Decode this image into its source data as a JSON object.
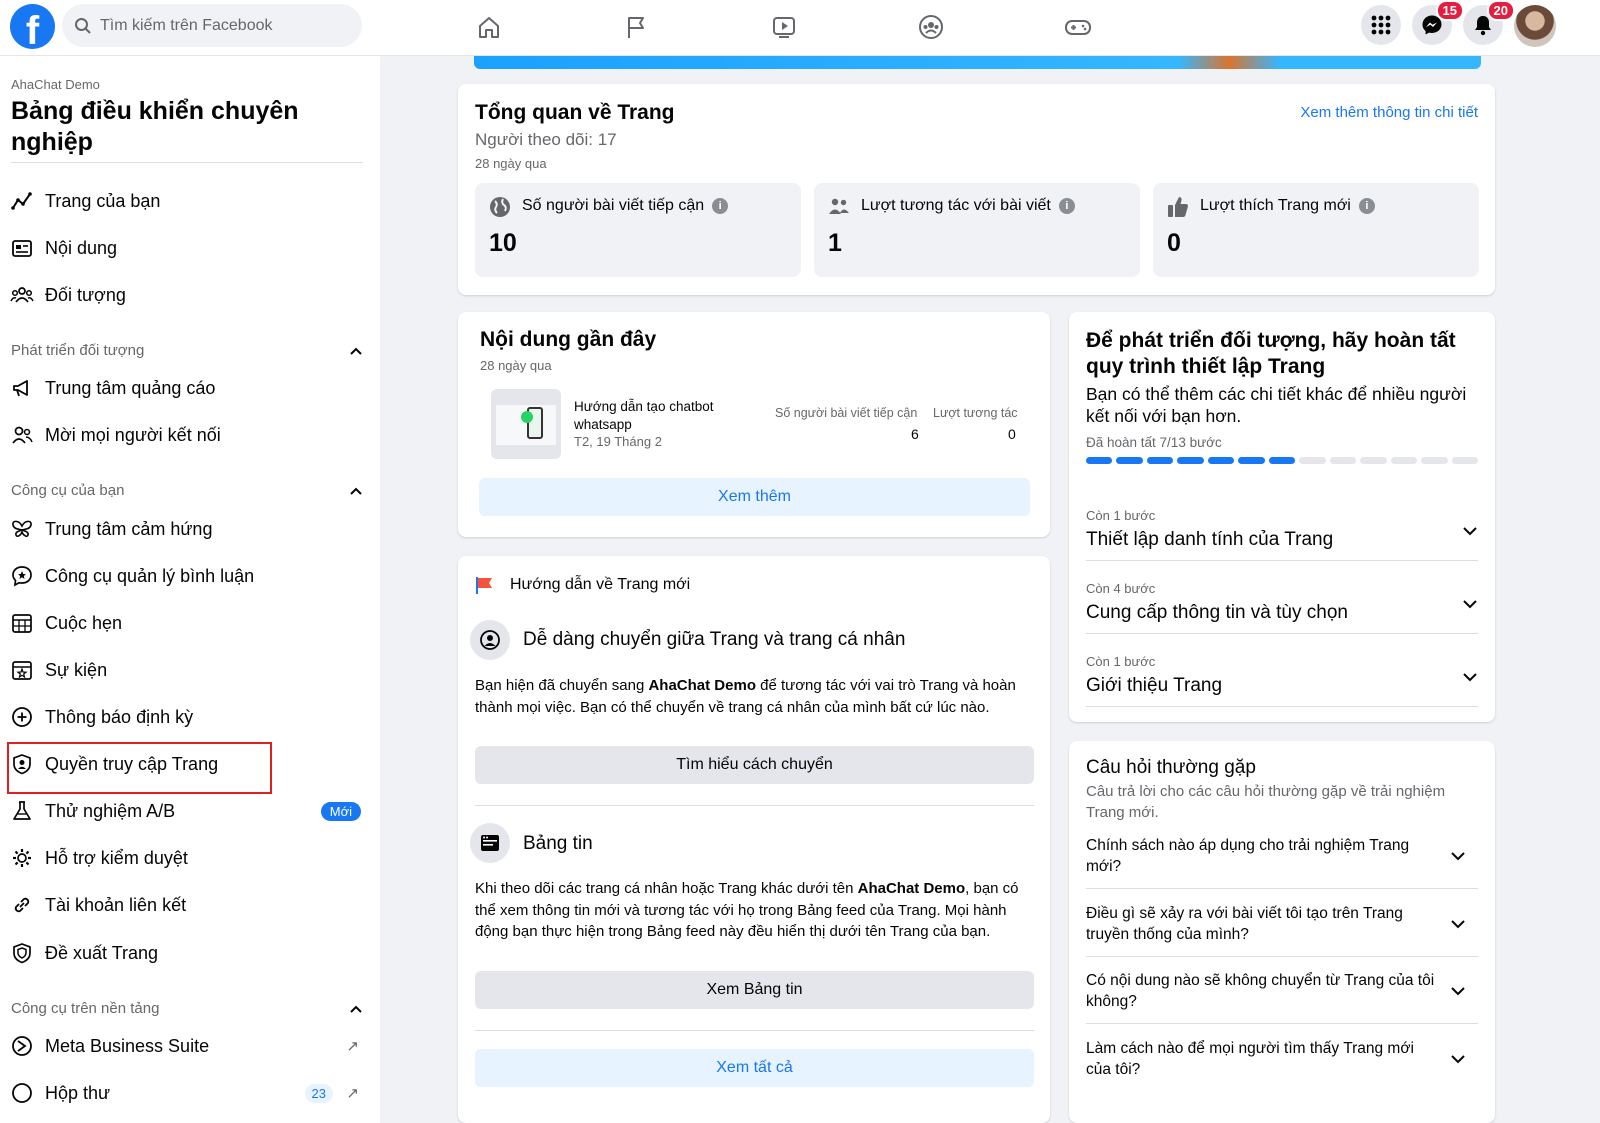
{
  "topbar": {
    "logo_letter": "f",
    "search_placeholder": "Tìm kiếm trên Facebook",
    "nav_icons": [
      "home-icon",
      "flag-icon",
      "video-icon",
      "groups-icon",
      "gaming-icon"
    ],
    "messenger_badge": "15",
    "notifications_badge": "20"
  },
  "sidebar": {
    "account_name": "AhaChat Demo",
    "title": "Bảng điều khiển chuyên nghiệp",
    "items_top": [
      {
        "label": "Trang của bạn",
        "icon": "insights-icon"
      },
      {
        "label": "Nội dung",
        "icon": "content-icon"
      },
      {
        "label": "Đối tượng",
        "icon": "audience-icon"
      }
    ],
    "section_grow": "Phát triển đối tượng",
    "items_grow": [
      {
        "label": "Trung tâm quảng cáo",
        "icon": "megaphone-icon"
      },
      {
        "label": "Mời mọi người kết nối",
        "icon": "invite-icon"
      }
    ],
    "section_tools": "Công cụ của bạn",
    "items_tools": [
      {
        "label": "Trung tâm cảm hứng",
        "icon": "butterfly-icon"
      },
      {
        "label": "Công cụ quản lý bình luận",
        "icon": "comment-tool-icon"
      },
      {
        "label": "Cuộc hẹn",
        "icon": "calendar-grid-icon"
      },
      {
        "label": "Sự kiện",
        "icon": "event-icon"
      },
      {
        "label": "Thông báo định kỳ",
        "icon": "plus-circle-icon"
      },
      {
        "label": "Quyền truy cập Trang",
        "icon": "shield-user-icon"
      },
      {
        "label": "Thử nghiệm A/B",
        "icon": "flask-icon",
        "badge": "Mới"
      },
      {
        "label": "Hỗ trợ kiểm duyệt",
        "icon": "moderation-icon"
      },
      {
        "label": "Tài khoản liên kết",
        "icon": "link-icon"
      },
      {
        "label": "Đề xuất Trang",
        "icon": "shield-icon"
      }
    ],
    "section_platform": "Công cụ trên nền tảng",
    "items_platform": [
      {
        "label": "Meta Business Suite",
        "icon": "business-suite-icon"
      },
      {
        "label": "Hộp thư",
        "icon": "inbox-icon",
        "count": "23"
      }
    ]
  },
  "overview": {
    "title": "Tổng quan về Trang",
    "followers": "Người theo dõi: 17",
    "period": "28 ngày qua",
    "more_link": "Xem thêm thông tin chi tiết",
    "stats": [
      {
        "label": "Số người bài viết tiếp cận",
        "value": "10",
        "icon": "globe-icon"
      },
      {
        "label": "Lượt tương tác với bài viết",
        "value": "1",
        "icon": "people-icon"
      },
      {
        "label": "Lượt thích Trang mới",
        "value": "0",
        "icon": "thumbs-up-icon"
      }
    ]
  },
  "recent": {
    "title": "Nội dung gần đây",
    "period": "28 ngày qua",
    "post_title": "Hướng dẫn tạo chatbot whatsapp",
    "post_date": "T2, 19 Tháng 2",
    "col_reach": "Số người bài viết tiếp cận",
    "col_engage": "Lượt tương tác",
    "reach_value": "6",
    "engage_value": "0",
    "see_more": "Xem thêm"
  },
  "guide": {
    "header": "Hướng dẫn về Trang mới",
    "s1_title": "Dễ dàng chuyển giữa Trang và trang cá nhân",
    "s1_p1": "Bạn hiện đã chuyển sang ",
    "s1_name": "AhaChat Demo",
    "s1_p2": " để tương tác với vai trò Trang và hoàn thành mọi việc. Bạn có thể chuyển về trang cá nhân của mình bất cứ lúc nào.",
    "s1_button": "Tìm hiểu cách chuyển",
    "s2_title": "Bảng tin",
    "s2_p1": "Khi theo dõi các trang cá nhân hoặc Trang khác dưới tên ",
    "s2_name": "AhaChat Demo",
    "s2_p2": ", bạn có thể xem thông tin mới và tương tác với họ trong Bảng feed của Trang. Mọi hành động bạn thực hiện trong Bảng feed này đều hiển thị dưới tên Trang của bạn.",
    "s2_button": "Xem Bảng tin",
    "see_all": "Xem tất cả"
  },
  "setup": {
    "title": "Để phát triển đối tượng, hãy hoàn tất quy trình thiết lập Trang",
    "subtitle": "Bạn có thể thêm các chi tiết khác để nhiều người kết nối với bạn hơn.",
    "progress_label": "Đã hoàn tất 7/13 bước",
    "progress_done": 7,
    "progress_total": 13,
    "steps": [
      {
        "remaining": "Còn 1 bước",
        "title": "Thiết lập danh tính của Trang"
      },
      {
        "remaining": "Còn 4 bước",
        "title": "Cung cấp thông tin và tùy chọn"
      },
      {
        "remaining": "Còn 1 bước",
        "title": "Giới thiệu Trang"
      }
    ]
  },
  "faq": {
    "title": "Câu hỏi thường gặp",
    "subtitle": "Câu trả lời cho các câu hỏi thường gặp về trải nghiệm Trang mới.",
    "questions": [
      "Chính sách nào áp dụng cho trải nghiệm Trang mới?",
      "Điều gì sẽ xảy ra với bài viết tôi tạo trên Trang truyền thống của mình?",
      "Có nội dung nào sẽ không chuyển từ Trang của tôi không?",
      "Làm cách nào để mọi người tìm thấy Trang mới của tôi?"
    ]
  },
  "colors": {
    "brand": "#1877f2",
    "highlight_box": "#e02020",
    "badge_red": "#e41e3f"
  }
}
